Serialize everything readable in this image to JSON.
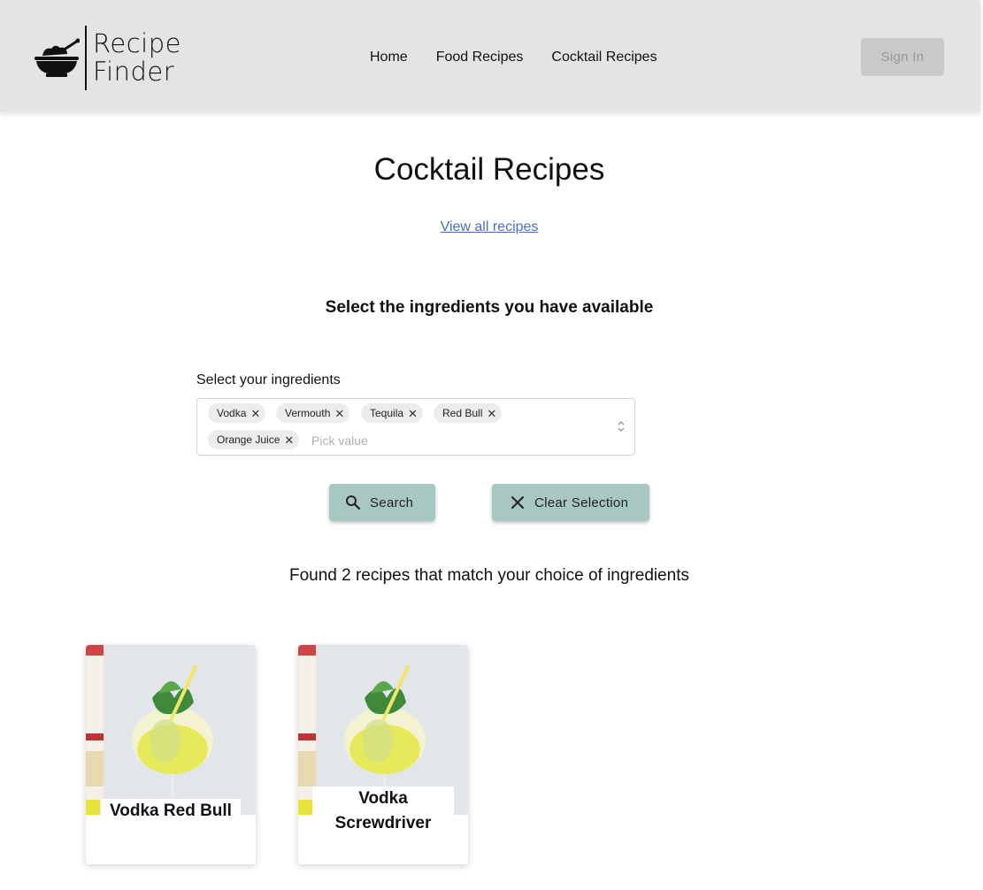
{
  "header": {
    "logo_line1": "Recipe",
    "logo_line2": "Finder",
    "nav": [
      "Home",
      "Food Recipes",
      "Cocktail Recipes"
    ],
    "signin_label": "Sign In"
  },
  "main": {
    "title": "Cocktail Recipes",
    "view_all_link": "View all recipes",
    "subtitle": "Select the ingredients you have available",
    "ingredients_label": "Select your ingredients",
    "selected_ingredients": [
      "Vodka",
      "Vermouth",
      "Tequila",
      "Red Bull",
      "Orange Juice"
    ],
    "ingredients_placeholder": "Pick value",
    "search_button": "Search",
    "clear_button": "Clear Selection",
    "results_text": "Found 2 recipes that match your choice of ingredients"
  },
  "recipes": [
    {
      "title": "Vodka Red Bull"
    },
    {
      "title": "Vodka Screwdriver"
    }
  ],
  "colors": {
    "header_bg": "#e4e4e4",
    "button_bg": "#a7c7c0",
    "link": "#4a6fc1",
    "signin_bg": "#c9c9c9"
  }
}
